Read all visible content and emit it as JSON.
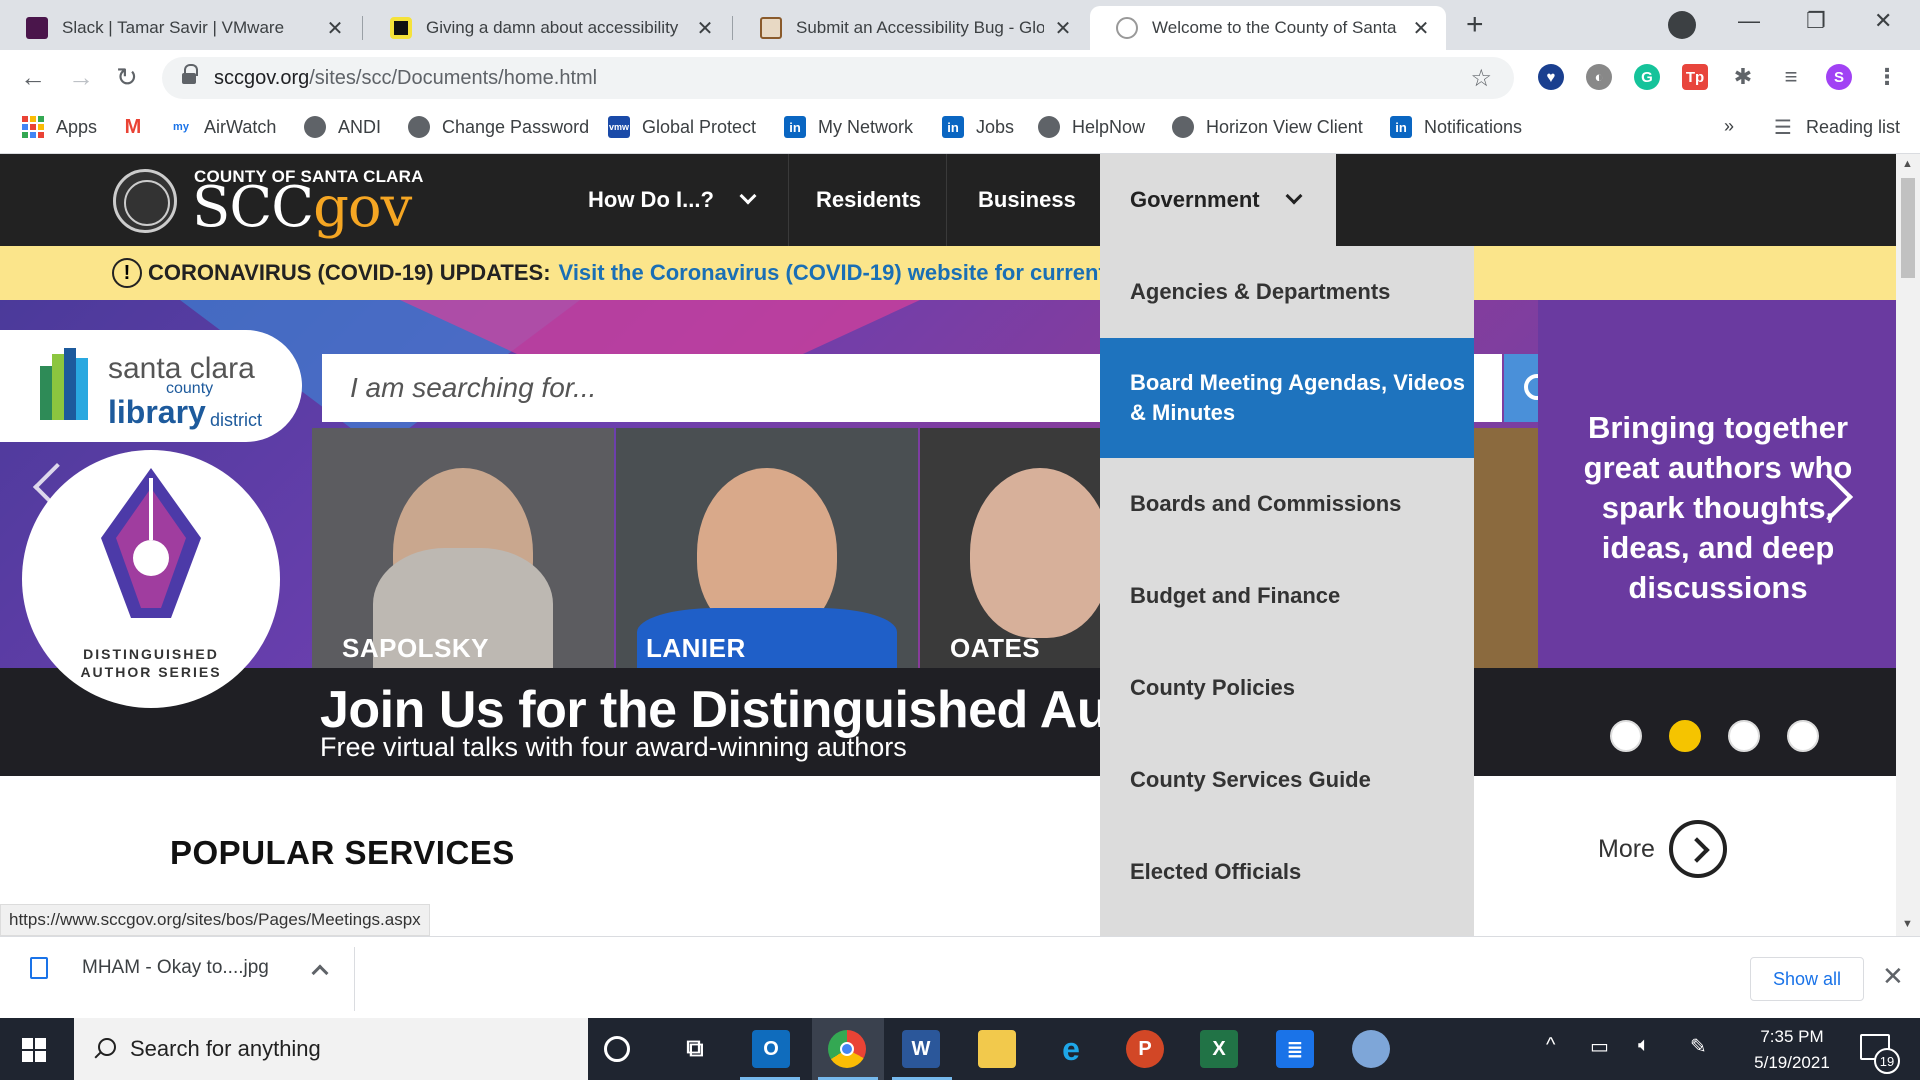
{
  "browser": {
    "tabs": [
      {
        "title": "Slack | Tamar Savir | VMware",
        "active": false
      },
      {
        "title": "Giving a damn about accessibility",
        "active": false
      },
      {
        "title": "Submit an Accessibility Bug - Glo",
        "active": false
      },
      {
        "title": "Welcome to the County of Santa",
        "active": true
      }
    ],
    "new_tab": "+",
    "url_host": "sccgov.org",
    "url_path": "/sites/scc/Documents/home.html",
    "profile_initial": "S",
    "bookmarks": [
      "Apps",
      "AirWatch",
      "ANDI",
      "Change Password",
      "Global Protect",
      "My Network",
      "Jobs",
      "HelpNow",
      "Horizon View Client",
      "Notifications"
    ],
    "bookmarks_overflow": "»",
    "reading_list": "Reading list"
  },
  "site": {
    "logo_small": "COUNTY OF SANTA CLARA",
    "logo_scc": "SCC",
    "logo_gov": "gov",
    "nav": {
      "how_do_i": "How Do I...?",
      "residents": "Residents",
      "business": "Business",
      "government": "Government"
    },
    "covid_label": "CORONAVIRUS (COVID-19) UPDATES:",
    "covid_link": "Visit the Coronavirus (COVID-19) website for current inf",
    "library": {
      "line1": "santa clara",
      "line2": "county",
      "line3": "library",
      "line4": "district"
    },
    "search_placeholder": "I am searching for...",
    "das_label_1": "DISTINGUISHED",
    "das_label_2": "AUTHOR SERIES",
    "authors": [
      "SAPOLSKY",
      "LANIER",
      "OATES"
    ],
    "hero_title": "Join Us for the Distinguished Autho",
    "hero_subtitle": "Free virtual talks with four award-winning authors",
    "promo_text": "Bringing together great authors who spark thoughts, ideas, and deep discussions",
    "carousel_active_index": 1,
    "popular_services": "POPULAR SERVICES",
    "more": "More",
    "dropdown": [
      {
        "label": "Agencies & Departments",
        "highlighted": false
      },
      {
        "label": "Board Meeting Agendas, Videos & Minutes",
        "highlighted": true
      },
      {
        "label": "Boards and Commissions",
        "highlighted": false
      },
      {
        "label": "Budget and Finance",
        "highlighted": false
      },
      {
        "label": "County Policies",
        "highlighted": false
      },
      {
        "label": "County Services Guide",
        "highlighted": false
      },
      {
        "label": "Elected Officials",
        "highlighted": false
      }
    ],
    "status_url": "https://www.sccgov.org/sites/bos/Pages/Meetings.aspx"
  },
  "download_bar": {
    "file": "MHAM - Okay to....jpg",
    "show_all": "Show all"
  },
  "taskbar": {
    "search_placeholder": "Search for anything",
    "time": "7:35 PM",
    "date": "5/19/2021",
    "notification_count": "19"
  },
  "colors": {
    "accent_blue": "#1e73be",
    "covid_yellow": "#fbe58b",
    "gov_orange": "#f5a623",
    "dot_active": "#f5c400"
  }
}
